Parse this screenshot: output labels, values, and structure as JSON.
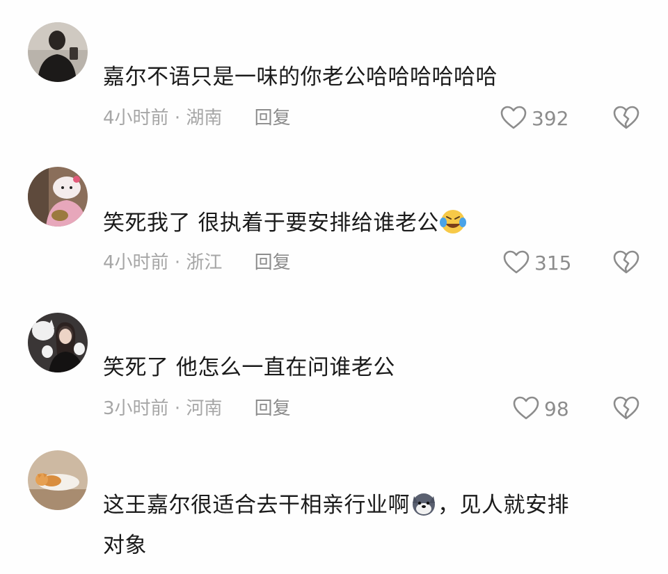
{
  "comments": [
    {
      "text": "嘉尔不语只是一味的你老公哈哈哈哈哈哈",
      "time": "4小时前",
      "location": "湖南",
      "reply_label": "回复",
      "likes": "392"
    },
    {
      "text": "笑死我了 很执着于要安排给谁老公",
      "emoji": "laughing-crying-emoji",
      "time": "4小时前",
      "location": "浙江",
      "reply_label": "回复",
      "likes": "315"
    },
    {
      "text": "笑死了 他怎么一直在问谁老公",
      "time": "3小时前",
      "location": "河南",
      "reply_label": "回复",
      "likes": "98"
    },
    {
      "text_part1": "这王嘉尔很适合去干相亲行业啊",
      "emoji": "husky-dog-emoji",
      "text_part2": "，见人就安排",
      "text_line2": "对象"
    }
  ],
  "meta_separator": "·",
  "colors": {
    "text": "#1a1a1a",
    "meta": "#a6a6a6",
    "icon": "#8c8c8c"
  }
}
